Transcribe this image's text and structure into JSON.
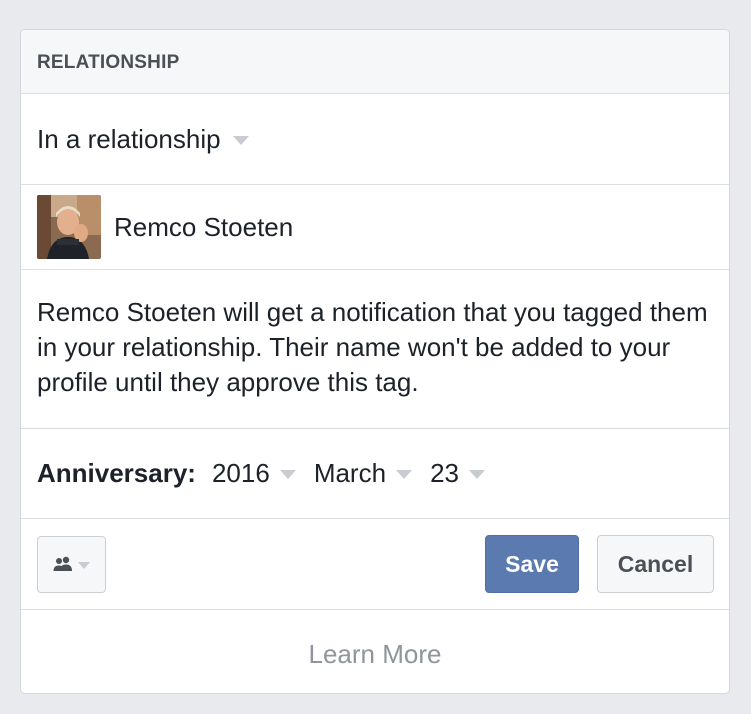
{
  "header": {
    "title": "RELATIONSHIP"
  },
  "status": {
    "selected": "In a relationship"
  },
  "partner": {
    "name": "Remco Stoeten",
    "avatar_icon": "profile-photo"
  },
  "notice": {
    "text": "Remco Stoeten will get a notification that you tagged them in your relationship. Their name won't be added to your profile until they approve this tag."
  },
  "anniversary": {
    "label": "Anniversary:",
    "year": "2016",
    "month": "March",
    "day": "23"
  },
  "actions": {
    "audience_icon": "friends-icon",
    "save_label": "Save",
    "cancel_label": "Cancel"
  },
  "footer": {
    "learn_more": "Learn More"
  },
  "colors": {
    "background": "#e9eaed",
    "primary_button": "#5b7bb0",
    "text": "#1d2129",
    "muted_text": "#90949c",
    "header_text": "#4b4f56"
  }
}
